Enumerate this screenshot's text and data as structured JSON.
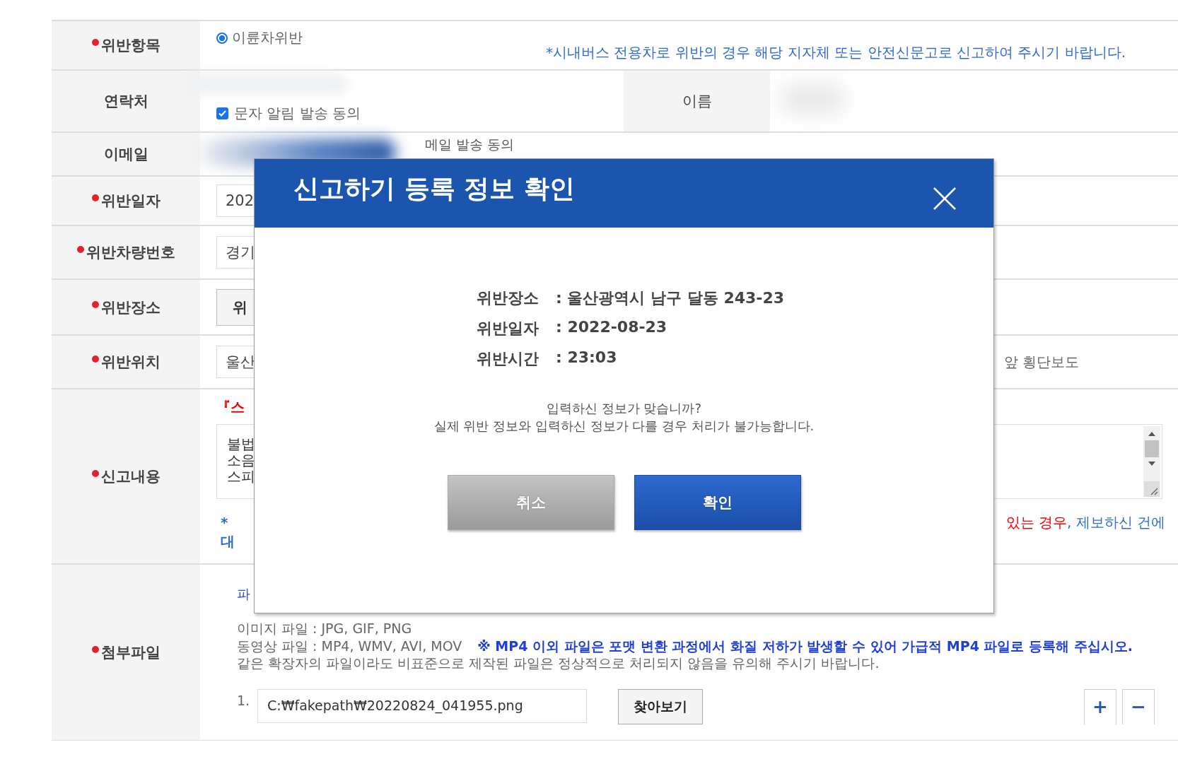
{
  "form": {
    "rows": [
      {
        "kind": "radio",
        "label": "위반항목",
        "required": true,
        "option": {
          "label": "이륜차위반",
          "selected": true
        },
        "notice": "*시내버스 전용차로 위반의 경우 해당 지자체 또는 안전신문고로 신고하여 주시기 바랍니다."
      },
      {
        "kind": "contact",
        "label": "연락처",
        "required": false,
        "consent": {
          "label": "문자 알림 발송 동의",
          "checked": true
        },
        "name_label": "이름"
      },
      {
        "kind": "email",
        "label": "이메일",
        "required": false,
        "consent_text": "메일 발송 동의"
      },
      {
        "kind": "input",
        "label": "위반일자",
        "required": true,
        "value": "202"
      },
      {
        "kind": "input",
        "label": "위반차량번호",
        "required": true,
        "value": "경기"
      },
      {
        "kind": "button",
        "label": "위반장소",
        "required": true,
        "button": "위"
      },
      {
        "kind": "location",
        "label": "위반위치",
        "required": true,
        "value": "울산",
        "detail": "앞 횡단보도"
      },
      {
        "kind": "content",
        "label": "신고내용",
        "required": true,
        "heading": "『스",
        "lines": [
          "불법",
          "소음",
          "스피"
        ],
        "note_lines": [
          "*",
          "대"
        ],
        "note_right": [
          {
            "text": "있는 경우",
            "kind": "warning"
          },
          {
            "text": ", 제보하신 건에",
            "kind": "info"
          }
        ]
      },
      {
        "kind": "attachment",
        "label": "첨부파일",
        "required": true,
        "guide_title": "파",
        "lines": [
          "이미지 파일 : JPG, GIF, PNG",
          "동영상 파일 : MP4, WMV, AVI, MOV",
          "같은 확장자의 파일이라도 비표준으로 제작된 파일은 정상적으로 처리되지 않음을 유의해 주시기 바랍니다."
        ],
        "video_notice": "※ MP4 이외 파일은 포맷 변환 과정에서 화질 저하가 발생할 수 있어 가급적 MP4 파일로 등록해 주십시오.",
        "files": [
          {
            "number": "1.",
            "path": "C:₩fakepath₩20220824_041955.png",
            "browse": "찾아보기"
          }
        ],
        "add": "+",
        "remove": "−"
      }
    ]
  },
  "dialog": {
    "title": "신고하기 등록 정보 확인",
    "details": [
      {
        "label": "위반장소",
        "value": ": 울산광역시 남구 달동 243-23"
      },
      {
        "label": "위반일자",
        "value": ": 2022-08-23"
      },
      {
        "label": "위반시간",
        "value": ": 23:03"
      }
    ],
    "message_lines": [
      "입력하신 정보가 맞습니까?",
      "실제 위반 정보와 입력하신 정보가 다를 경우 처리가 불가능합니다."
    ],
    "buttons": [
      {
        "label": "취소",
        "kind": "cancel"
      },
      {
        "label": "확인",
        "kind": "confirm"
      }
    ]
  }
}
